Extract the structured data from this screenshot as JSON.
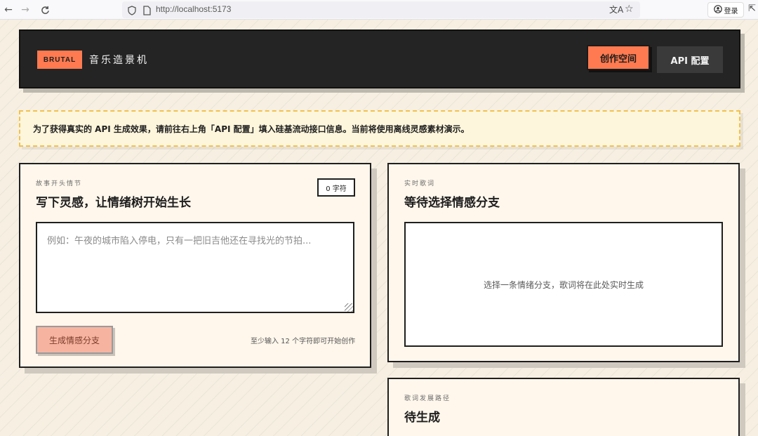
{
  "browser": {
    "url": "http://localhost:5173",
    "login_label": "登录"
  },
  "header": {
    "badge": "BRUTAL",
    "title": "音乐造景机",
    "workspace_label": "创作空间",
    "api_label": "API 配置"
  },
  "notice": {
    "text": "为了获得真实的 API 生成效果，请前往右上角「API 配置」填入硅基流动接口信息。当前将使用离线灵感素材演示。"
  },
  "story_card": {
    "kicker": "故事开头情节",
    "title": "写下灵感，让情绪树开始生长",
    "char_count": "0 字符",
    "placeholder": "例如：午夜的城市陷入停电，只有一把旧吉他还在寻找光的节拍...",
    "generate_label": "生成情感分支",
    "hint": "至少输入 12 个字符即可开始创作"
  },
  "lyrics_card": {
    "kicker": "实时歌词",
    "title": "等待选择情感分支",
    "empty_text": "选择一条情绪分支，歌词将在此处实时生成"
  },
  "path_card": {
    "kicker": "歌词发展路径",
    "title": "待生成"
  },
  "colors": {
    "accent": "#ff7a50",
    "header_bg": "#242424",
    "notice_border": "#f2c14e",
    "card_bg": "#fff7ec"
  }
}
